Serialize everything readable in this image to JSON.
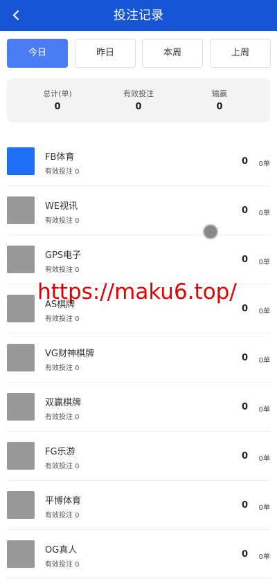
{
  "header": {
    "title": "投注记录",
    "back_icon": "chevron-left-icon",
    "color": "#1656d6"
  },
  "tabs": [
    {
      "label": "今日",
      "active": true
    },
    {
      "label": "昨日",
      "active": false
    },
    {
      "label": "本周",
      "active": false
    },
    {
      "label": "上周",
      "active": false
    }
  ],
  "summary": [
    {
      "label": "总计(单)",
      "value": "0"
    },
    {
      "label": "有效投注",
      "value": "0"
    },
    {
      "label": "输赢",
      "value": "0"
    }
  ],
  "rows": [
    {
      "name": "FB体育",
      "sub": "有效投注 0",
      "amount": "0",
      "count": "0单"
    },
    {
      "name": "WE视讯",
      "sub": "有效投注 0",
      "amount": "0",
      "count": "0单"
    },
    {
      "name": "GPS电子",
      "sub": "有效投注 0",
      "amount": "0",
      "count": "0单"
    },
    {
      "name": "AS棋牌",
      "sub": "有效投注 0",
      "amount": "0",
      "count": "0单"
    },
    {
      "name": "VG财神棋牌",
      "sub": "有效投注 0",
      "amount": "0",
      "count": "0单"
    },
    {
      "name": "双赢棋牌",
      "sub": "有效投注 0",
      "amount": "0",
      "count": "0单"
    },
    {
      "name": "FG乐游",
      "sub": "有效投注 0",
      "amount": "0",
      "count": "0单"
    },
    {
      "name": "平博体育",
      "sub": "有效投注 0",
      "amount": "0",
      "count": "0单"
    },
    {
      "name": "OG真人",
      "sub": "有效投注 0",
      "amount": "0",
      "count": "0单"
    }
  ],
  "watermark": "https://maku6.top/",
  "colors": {
    "active_tab": "#4a7cf6",
    "first_thumb": "#1f6ff5",
    "placeholder_thumb": "#999999",
    "watermark": "#e30000"
  }
}
